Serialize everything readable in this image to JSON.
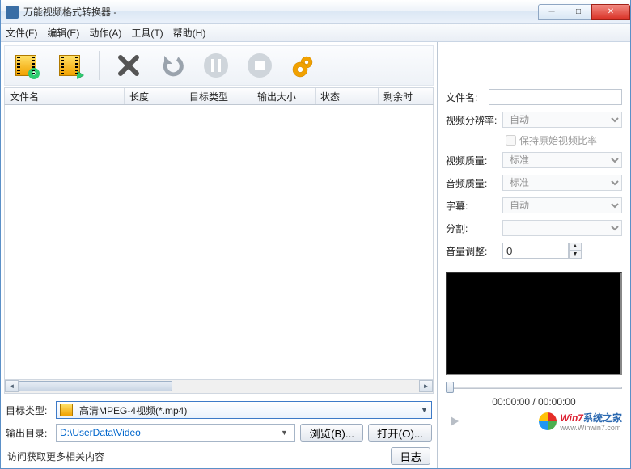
{
  "window_title": "万能视频格式转换器 - ",
  "menu": {
    "file": "文件(F)",
    "edit": "编辑(E)",
    "action": "动作(A)",
    "tools": "工具(T)",
    "help": "帮助(H)"
  },
  "toolbar": {
    "add_file": "add-file",
    "convert": "convert",
    "delete": "delete",
    "undo": "undo",
    "pause": "pause",
    "stop": "stop",
    "settings": "settings"
  },
  "columns": {
    "filename": "文件名",
    "length": "长度",
    "target_type": "目标类型",
    "output_size": "输出大小",
    "status": "状态",
    "remaining": "剩余时"
  },
  "col_widths": {
    "filename": 148,
    "length": 74,
    "target_type": 84,
    "output_size": 78,
    "status": 78,
    "remaining": 60
  },
  "target": {
    "label": "目标类型:",
    "value": "高清MPEG-4视频(*.mp4)"
  },
  "output_dir": {
    "label": "输出目录:",
    "value": "D:\\UserData\\Video"
  },
  "buttons": {
    "browse": "浏览(B)...",
    "open": "打开(O)...",
    "log": "日志"
  },
  "link_more": "访问获取更多相关内容",
  "props": {
    "filename_label": "文件名:",
    "filename_value": "",
    "resolution_label": "视频分辨率:",
    "resolution_value": "自动",
    "keep_ratio_label": "保持原始视频比率",
    "video_quality_label": "视频质量:",
    "video_quality_value": "标准",
    "audio_quality_label": "音频质量:",
    "audio_quality_value": "标准",
    "subtitle_label": "字幕:",
    "subtitle_value": "自动",
    "split_label": "分割:",
    "split_value": "",
    "volume_label": "音量调整:",
    "volume_value": "0"
  },
  "time_display": "00:00:00 / 00:00:00",
  "watermark": {
    "brand1": "Win7",
    "brand2": "系统之家",
    "url": "www.Winwin7.com"
  }
}
